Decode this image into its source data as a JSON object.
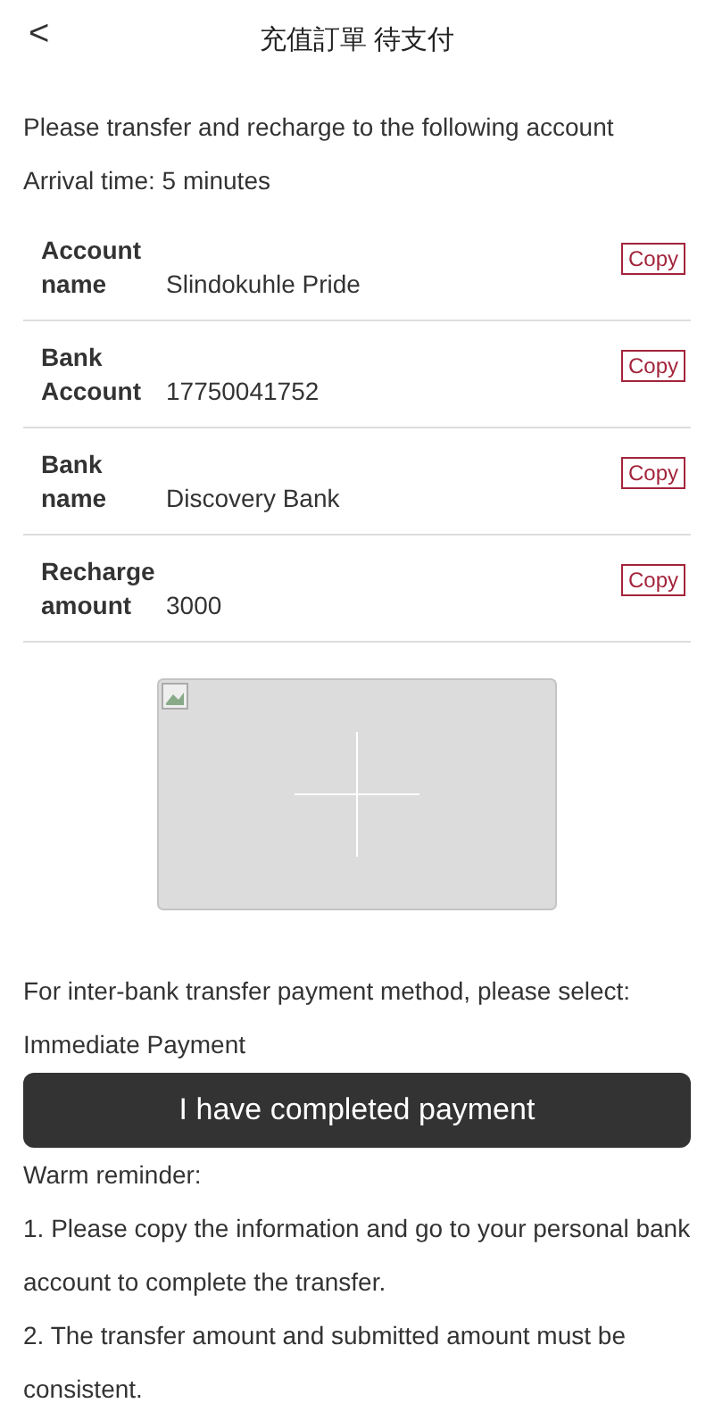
{
  "header": {
    "back_icon": "<",
    "title": "充值訂單 待支付"
  },
  "intro": [
    "Please transfer and recharge to the following account",
    "Arrival time: 5 minutes"
  ],
  "details": [
    {
      "label": "Account name",
      "value": "Slindokuhle Pride",
      "action": "Copy"
    },
    {
      "label": "Bank Account",
      "value": "17750041752",
      "action": "Copy"
    },
    {
      "label": "Bank name",
      "value": "Discovery Bank",
      "action": "Copy"
    },
    {
      "label": "Recharge amount",
      "value": "3000",
      "action": "Copy"
    }
  ],
  "method_prompt": "For inter-bank transfer payment method, please select:",
  "method": "Immediate Payment",
  "submit_button": "I have completed payment",
  "reminder_title": "Warm reminder:",
  "reminders": [
    "1. Please copy the information and go to your personal bank account to complete the transfer.",
    "2. The transfer amount and submitted amount must be consistent."
  ]
}
